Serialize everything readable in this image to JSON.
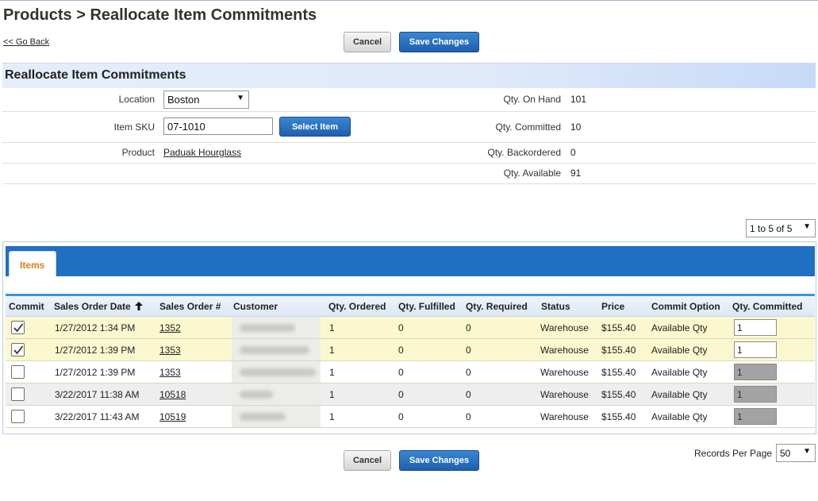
{
  "page": {
    "title": "Products > Reallocate Item Commitments",
    "back_link": "<< Go Back"
  },
  "actions": {
    "cancel_label": "Cancel",
    "save_label": "Save Changes"
  },
  "section": {
    "title": "Reallocate Item Commitments"
  },
  "form": {
    "location_label": "Location",
    "location_value": "Boston",
    "sku_label": "Item SKU",
    "sku_value": "07-1010",
    "select_item_label": "Select Item",
    "product_label": "Product",
    "product_value": "Paduak Hourglass"
  },
  "stats": {
    "on_hand_label": "Qty. On Hand",
    "on_hand_value": "101",
    "committed_label": "Qty. Committed",
    "committed_value": "10",
    "backordered_label": "Qty. Backordered",
    "backordered_value": "0",
    "available_label": "Qty. Available",
    "available_value": "91"
  },
  "pager": {
    "range": "1 to 5 of 5"
  },
  "tabs": {
    "items": "Items"
  },
  "table": {
    "headers": {
      "commit": "Commit",
      "date": "Sales Order Date",
      "order": "Sales Order #",
      "customer": "Customer",
      "ordered": "Qty. Ordered",
      "fulfilled": "Qty. Fulfilled",
      "required": "Qty. Required",
      "status": "Status",
      "price": "Price",
      "option": "Commit Option",
      "qty_committed": "Qty. Committed"
    },
    "sort_icon": "arrow-up-icon",
    "rows": [
      {
        "checked": true,
        "date": "1/27/2012 1:34 PM",
        "order": "1352",
        "ordered": "1",
        "fulfilled": "0",
        "required": "0",
        "status": "Warehouse",
        "price": "$155.40",
        "option": "Available Qty",
        "qty": "1",
        "enabled": true
      },
      {
        "checked": true,
        "date": "1/27/2012 1:39 PM",
        "order": "1353",
        "ordered": "1",
        "fulfilled": "0",
        "required": "0",
        "status": "Warehouse",
        "price": "$155.40",
        "option": "Available Qty",
        "qty": "1",
        "enabled": true
      },
      {
        "checked": false,
        "date": "1/27/2012 1:39 PM",
        "order": "1353",
        "ordered": "1",
        "fulfilled": "0",
        "required": "0",
        "status": "Warehouse",
        "price": "$155.40",
        "option": "Available Qty",
        "qty": "1",
        "enabled": false
      },
      {
        "checked": false,
        "date": "3/22/2017 11:38 AM",
        "order": "10518",
        "ordered": "1",
        "fulfilled": "0",
        "required": "0",
        "status": "Warehouse",
        "price": "$155.40",
        "option": "Available Qty",
        "qty": "1",
        "enabled": false
      },
      {
        "checked": false,
        "date": "3/22/2017 11:43 AM",
        "order": "10519",
        "ordered": "1",
        "fulfilled": "0",
        "required": "0",
        "status": "Warehouse",
        "price": "$155.40",
        "option": "Available Qty",
        "qty": "1",
        "enabled": false
      }
    ]
  },
  "footer": {
    "records_label": "Records Per Page",
    "records_value": "50"
  },
  "colors": {
    "checked_row": "#fbf8cf",
    "unchecked_row": "#ffffff",
    "alt_row": "#eeeeee",
    "tab_bar": "#1f6fc2",
    "tab_text": "#e07a1a"
  }
}
